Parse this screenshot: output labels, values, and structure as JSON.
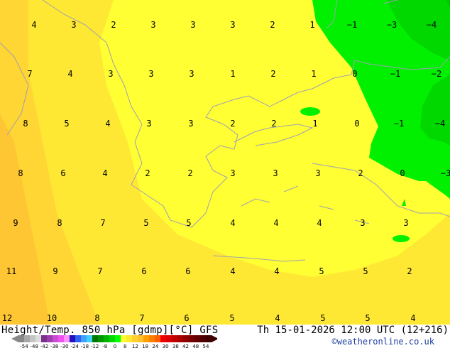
{
  "map": {
    "colors": {
      "yellow": "#ffff33",
      "yellow_orange": "#ffe833",
      "light_orange": "#ffd633",
      "orange": "#ffc633",
      "green": "#00f000",
      "green_dark": "#00d800",
      "green_darker": "#00c400",
      "coastline": "#a0a0b4"
    },
    "labels": [
      "4",
      "3",
      "2",
      "3",
      "3",
      "3",
      "2",
      "1",
      "-1",
      "-3",
      "-4",
      "7",
      "4",
      "3",
      "3",
      "3",
      "1",
      "2",
      "1",
      "0",
      "-1",
      "-2",
      "8",
      "5",
      "4",
      "3",
      "3",
      "2",
      "2",
      "1",
      "0",
      "-1",
      "-4",
      "8",
      "6",
      "4",
      "2",
      "2",
      "3",
      "3",
      "3",
      "2",
      "0",
      "-3",
      "9",
      "8",
      "7",
      "5",
      "5",
      "4",
      "4",
      "4",
      "3",
      "3",
      "11",
      "9",
      "7",
      "6",
      "6",
      "4",
      "4",
      "5",
      "5",
      "2",
      "12",
      "10",
      "8",
      "7",
      "6",
      "5",
      "4",
      "5",
      "5",
      "4"
    ]
  },
  "footer": {
    "title": "Height/Temp. 850 hPa [gdmp][°C] GFS",
    "datetime": "Th 15-01-2026 12:00 UTC (12+216)",
    "credit": "©weatheronline.co.uk"
  },
  "colorbar": {
    "ticks": [
      "-54",
      "-48",
      "-42",
      "-38",
      "-30",
      "-24",
      "-18",
      "-12",
      "-8",
      "0",
      "8",
      "12",
      "18",
      "24",
      "30",
      "38",
      "42",
      "48",
      "54"
    ],
    "colors": [
      "#888888",
      "#a8a8a8",
      "#c4c4c4",
      "#dcdcdc",
      "#7a2f8a",
      "#a03cb0",
      "#c84cd0",
      "#f050f0",
      "#ff90ff",
      "#2010c0",
      "#3060f0",
      "#40a0ff",
      "#40d0ff",
      "#007800",
      "#009600",
      "#00b400",
      "#00d800",
      "#00ff00",
      "#ffff30",
      "#ffe830",
      "#ffd030",
      "#ffc030",
      "#ffa000",
      "#ff8000",
      "#ff6000",
      "#f00000",
      "#d80000",
      "#c00000",
      "#a80000",
      "#900000",
      "#780000",
      "#600000",
      "#500000",
      "#400000"
    ]
  }
}
